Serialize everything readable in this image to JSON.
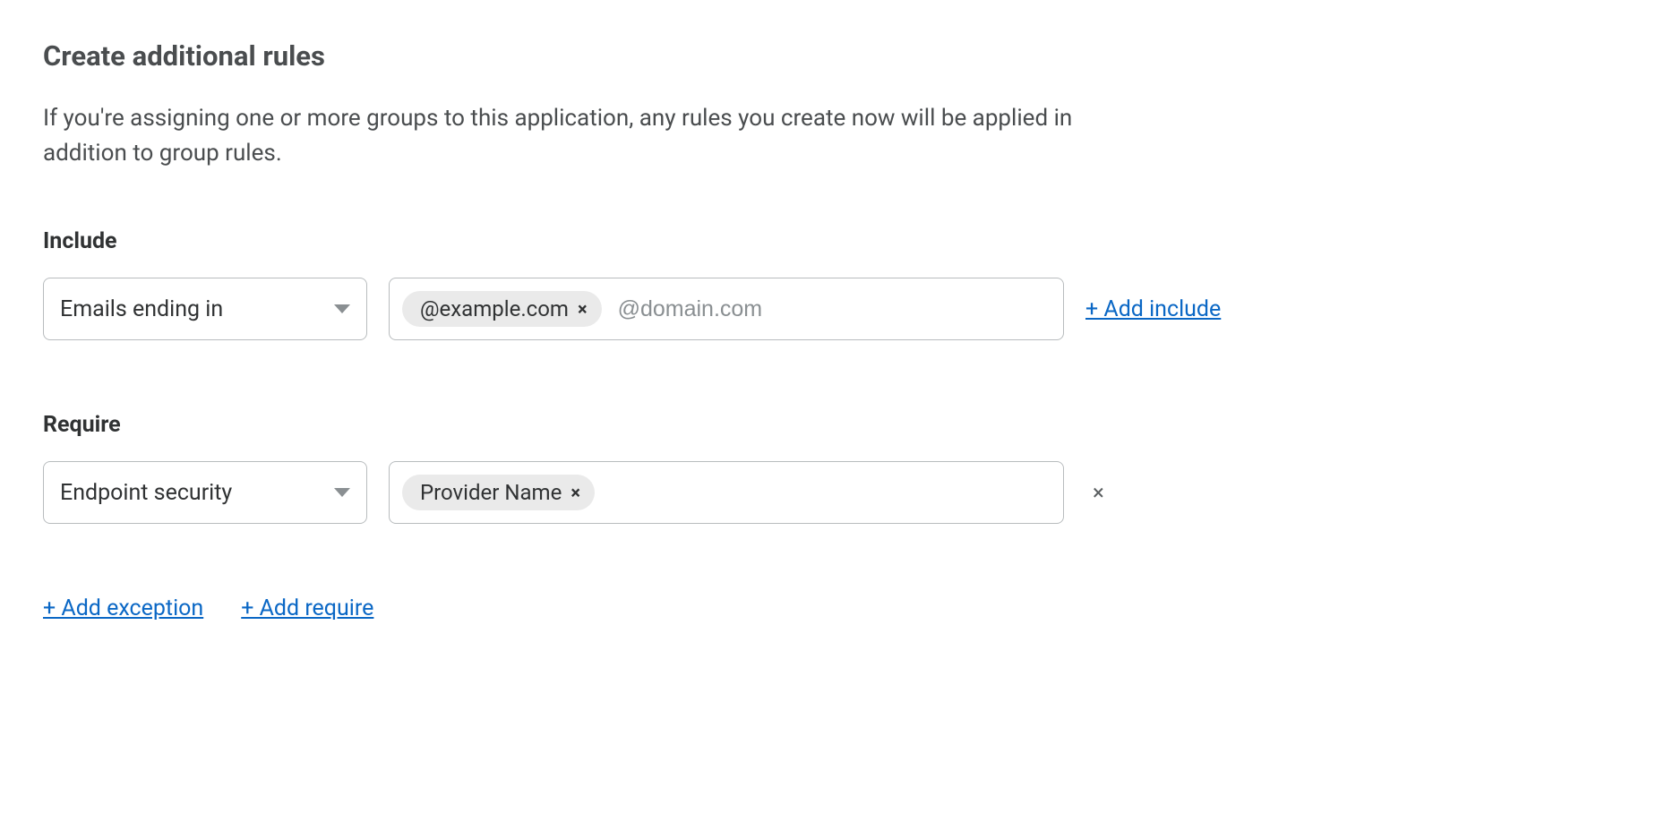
{
  "header": {
    "title": "Create additional rules",
    "description": "If you're assigning one or more groups to this application, any rules you create now will be applied in addition to group rules."
  },
  "include": {
    "label": "Include",
    "selector_value": "Emails ending in",
    "tags": [
      "@example.com"
    ],
    "input_placeholder": "@domain.com",
    "add_label": "+ Add include"
  },
  "require": {
    "label": "Require",
    "selector_value": "Endpoint security",
    "tags": [
      "Provider Name"
    ],
    "input_placeholder": ""
  },
  "actions": {
    "add_exception": "+ Add exception",
    "add_require": "+ Add require"
  },
  "glyphs": {
    "tag_remove": "×",
    "row_remove": "×"
  }
}
